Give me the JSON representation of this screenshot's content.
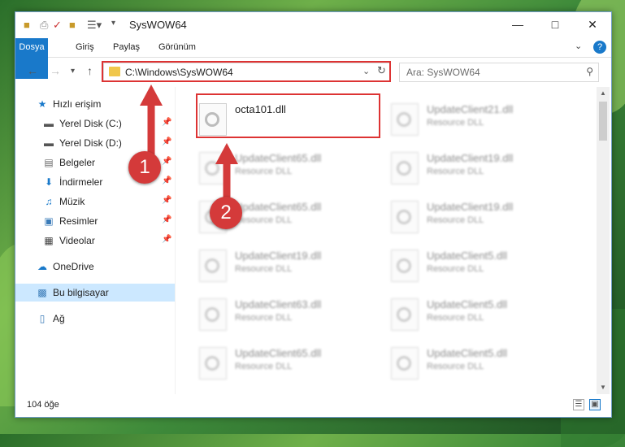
{
  "window": {
    "title": "SysWOW64"
  },
  "ribbon": {
    "tabs": [
      "Dosya",
      "Giriş",
      "Paylaş",
      "Görünüm"
    ]
  },
  "nav": {
    "address": "C:\\Windows\\SysWOW64",
    "search_placeholder": "Ara: SysWOW64"
  },
  "sidebar": {
    "items": [
      {
        "label": "Hızlı erişim",
        "icon": "star-icon",
        "pinned": false
      },
      {
        "label": "Yerel Disk (C:)",
        "icon": "drive-icon",
        "pinned": true
      },
      {
        "label": "Yerel Disk (D:)",
        "icon": "drive-icon",
        "pinned": true
      },
      {
        "label": "Belgeler",
        "icon": "document-icon",
        "pinned": true
      },
      {
        "label": "İndirmeler",
        "icon": "download-icon",
        "pinned": true
      },
      {
        "label": "Müzik",
        "icon": "music-icon",
        "pinned": true
      },
      {
        "label": "Resimler",
        "icon": "image-icon",
        "pinned": true
      },
      {
        "label": "Videolar",
        "icon": "video-icon",
        "pinned": true
      },
      {
        "label": "OneDrive",
        "icon": "cloud-icon",
        "pinned": false
      },
      {
        "label": "Bu bilgisayar",
        "icon": "computer-icon",
        "pinned": false,
        "selected": true
      },
      {
        "label": "Ağ",
        "icon": "network-icon",
        "pinned": false
      }
    ]
  },
  "files": [
    {
      "name": "octa101.dll",
      "type": ""
    },
    {
      "name": "UpdateClient21.dll",
      "type": "Resource DLL"
    },
    {
      "name": "UpdateClient65.dll",
      "type": "Resource DLL"
    },
    {
      "name": "UpdateClient19.dll",
      "type": "Resource DLL"
    },
    {
      "name": "UpdateClient65.dll",
      "type": "Resource DLL"
    },
    {
      "name": "UpdateClient19.dll",
      "type": "Resource DLL"
    },
    {
      "name": "UpdateClient19.dll",
      "type": "Resource DLL"
    },
    {
      "name": "UpdateClient5.dll",
      "type": "Resource DLL"
    },
    {
      "name": "UpdateClient63.dll",
      "type": "Resource DLL"
    },
    {
      "name": "UpdateClient5.dll",
      "type": "Resource DLL"
    },
    {
      "name": "UpdateClient65.dll",
      "type": "Resource DLL"
    },
    {
      "name": "UpdateClient5.dll",
      "type": "Resource DLL"
    }
  ],
  "status": {
    "item_count": "104 öğe"
  },
  "annotations": {
    "marker1": "1",
    "marker2": "2"
  },
  "colors": {
    "accent": "#1979ca",
    "highlight": "#d33333",
    "selection": "#cce8ff"
  }
}
